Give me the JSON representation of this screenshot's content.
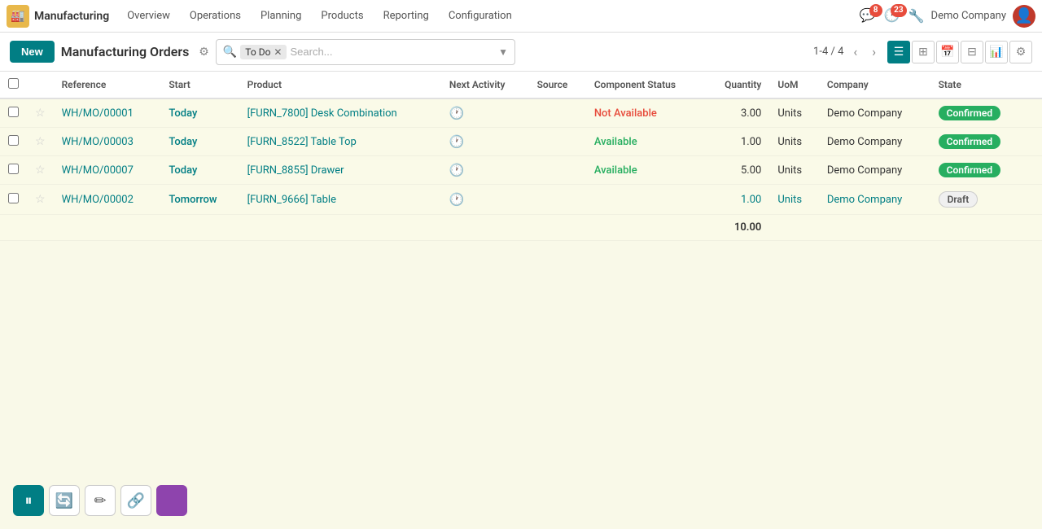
{
  "app": {
    "name": "Manufacturing",
    "logo_emoji": "🏭"
  },
  "nav": {
    "items": [
      "Overview",
      "Operations",
      "Planning",
      "Products",
      "Reporting",
      "Configuration"
    ],
    "badge_messages": "8",
    "badge_activity": "23",
    "company": "Demo Company"
  },
  "toolbar": {
    "new_label": "New",
    "page_title": "Manufacturing Orders",
    "search_filter": "To Do",
    "search_placeholder": "Search...",
    "pagination": "1-4 / 4"
  },
  "table": {
    "headers": [
      "Reference",
      "Start",
      "Product",
      "Next Activity",
      "Source",
      "Component Status",
      "Quantity",
      "UoM",
      "Company",
      "State"
    ],
    "rows": [
      {
        "ref": "WH/MO/00001",
        "start": "Today",
        "product": "[FURN_7800] Desk Combination",
        "component_status": "Not Available",
        "quantity": "3.00",
        "uom": "Units",
        "company": "Demo Company",
        "state": "Confirmed",
        "starred": false
      },
      {
        "ref": "WH/MO/00003",
        "start": "Today",
        "product": "[FURN_8522] Table Top",
        "component_status": "Available",
        "quantity": "1.00",
        "uom": "Units",
        "company": "Demo Company",
        "state": "Confirmed",
        "starred": false
      },
      {
        "ref": "WH/MO/00007",
        "start": "Today",
        "product": "[FURN_8855] Drawer",
        "component_status": "Available",
        "quantity": "5.00",
        "uom": "Units",
        "company": "Demo Company",
        "state": "Confirmed",
        "starred": false
      },
      {
        "ref": "WH/MO/00002",
        "start": "Tomorrow",
        "product": "[FURN_9666] Table",
        "component_status": "",
        "quantity": "1.00",
        "uom": "Units",
        "company": "Demo Company",
        "state": "Draft",
        "starred": false
      }
    ],
    "total": "10.00"
  },
  "views": [
    "list",
    "kanban",
    "calendar",
    "pivot",
    "chart",
    "settings"
  ]
}
